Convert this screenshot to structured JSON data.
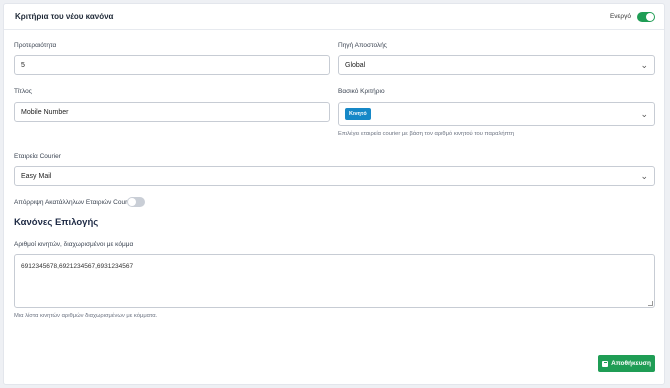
{
  "header": {
    "title": "Κριτήρια του νέου κανόνα",
    "active_label": "Ενεργό",
    "active_on": true
  },
  "priority": {
    "label": "Προτεραιότητα",
    "value": "5"
  },
  "source": {
    "label": "Πηγή Αποστολής",
    "value": "Global"
  },
  "title_field": {
    "label": "Τίτλος",
    "value": "Mobile Number"
  },
  "base_criterion": {
    "label": "Βασικό Κριτήριο",
    "chip": "Κινητό",
    "help": "Επιλέγει εταιρεία courier με βάση τον αριθμό κινητού του παραλήπτη"
  },
  "courier": {
    "label": "Εταιρεία Courier",
    "value": "Easy Mail"
  },
  "reject_toggle": {
    "label": "Απόρριψη Ακατάλληλων Εταιριών Courier",
    "on": false
  },
  "rules": {
    "title": "Κανόνες Επιλογής",
    "numbers_label": "Αριθμοί κινητών, διαχωρισμένοι με κόμμα",
    "numbers_value": "6912345678,6921234567,6931234567",
    "help": "Μια λίστα κινητών αριθμών διαχωρισμένων με κόμματα."
  },
  "save_label": "Αποθήκευση",
  "colors": {
    "accent_green": "#1f9d55",
    "chip_blue": "#1688c7"
  }
}
